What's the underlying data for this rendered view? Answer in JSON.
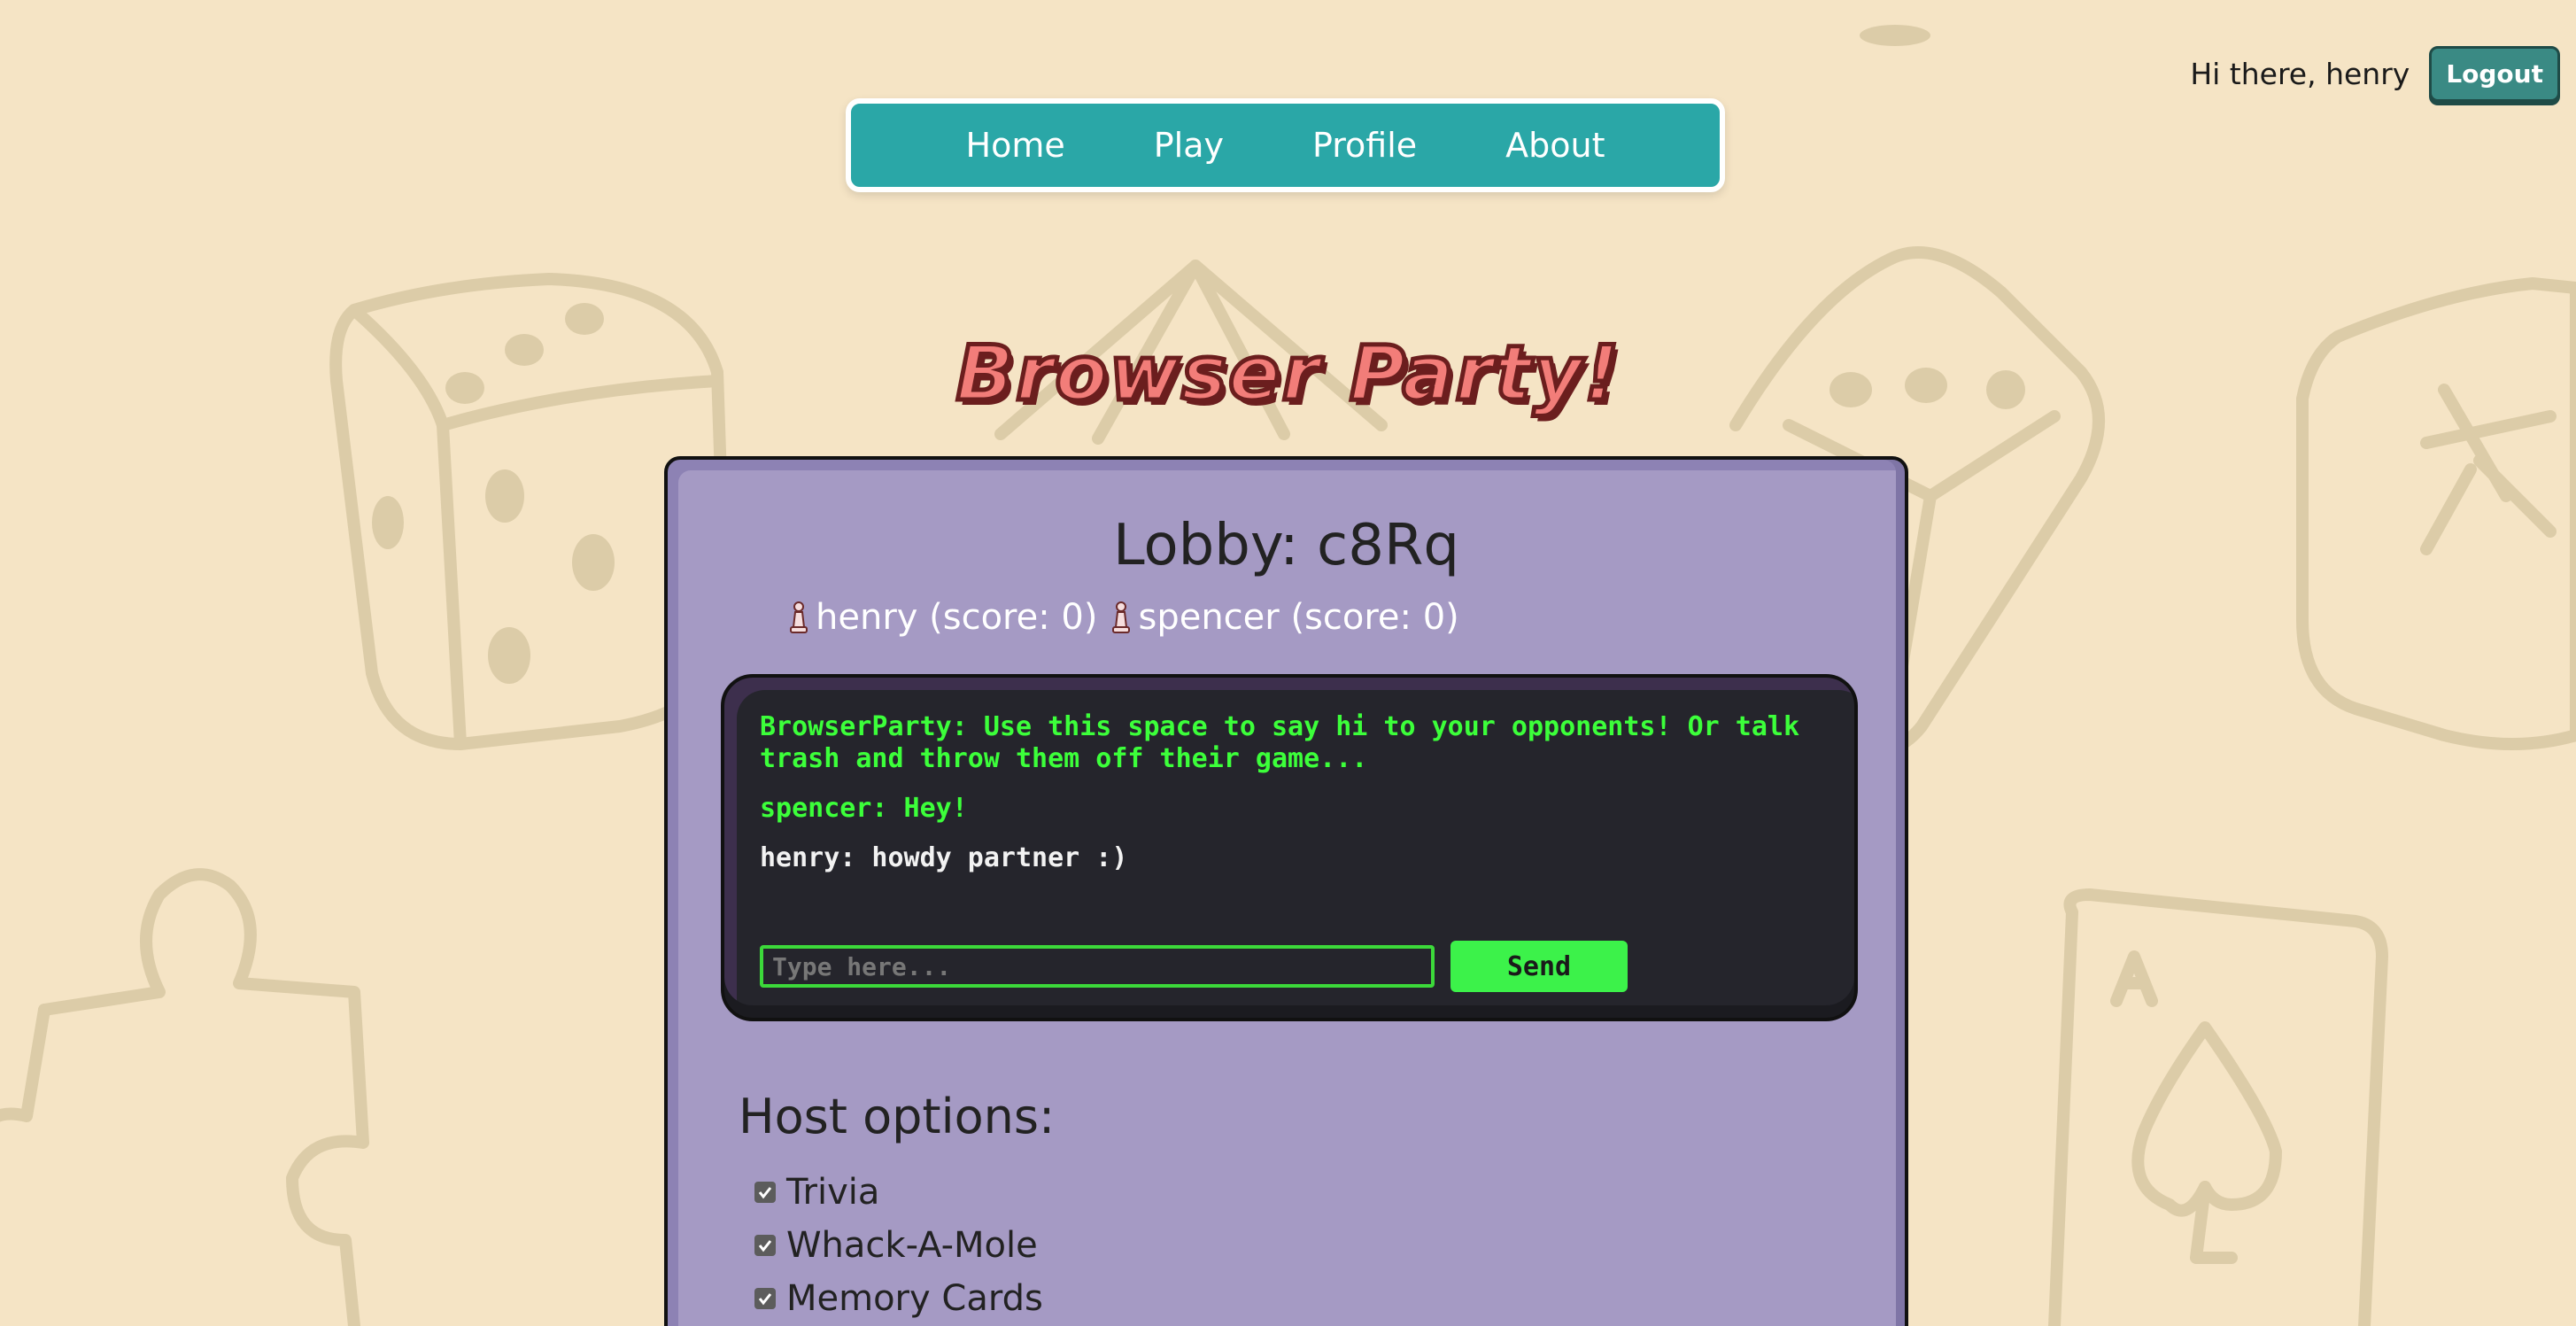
{
  "header": {
    "greeting": "Hi there, henry",
    "logout_label": "Logout"
  },
  "nav": {
    "items": [
      "Home",
      "Play",
      "Profile",
      "About"
    ]
  },
  "site_title": "Browser Party!",
  "lobby": {
    "title": "Lobby: c8Rq",
    "players": [
      {
        "label": "henry (score: 0)"
      },
      {
        "label": "spencer (score: 0)"
      }
    ]
  },
  "chat": {
    "messages": [
      {
        "text": "BrowserParty: Use this space to say hi to your opponents! Or talk trash and throw them off their game...",
        "color": "green"
      },
      {
        "text": "spencer: Hey!",
        "color": "green"
      },
      {
        "text": "henry: howdy partner :)",
        "color": "white"
      }
    ],
    "input_placeholder": "Type here...",
    "send_label": "Send"
  },
  "host_options": {
    "title": "Host options:",
    "options": [
      {
        "label": "Trivia",
        "checked": true
      },
      {
        "label": "Whack-A-Mole",
        "checked": true
      },
      {
        "label": "Memory Cards",
        "checked": true
      }
    ]
  },
  "background_icons": [
    "dice-icon",
    "d20-icon",
    "dice-icon",
    "mahjong-tile-icon",
    "puzzle-piece-icon",
    "ace-of-spades-card-icon"
  ],
  "colors": {
    "background": "#f5e4c5",
    "nav": "#2aa7a7",
    "card": "#a59ac4",
    "chat_bg": "#25252c",
    "chat_green": "#3cff3a",
    "title": "#f27d79"
  }
}
